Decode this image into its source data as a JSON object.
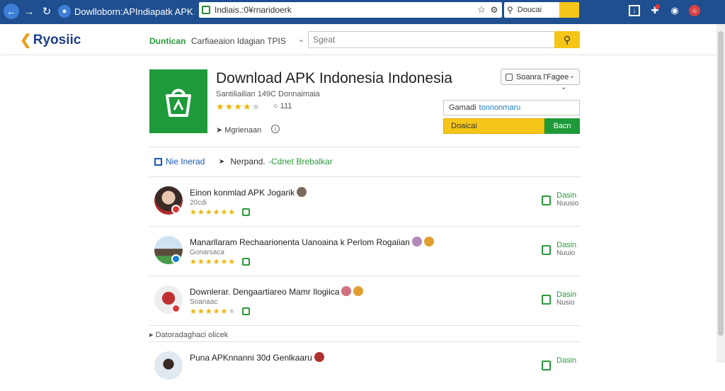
{
  "browser": {
    "tab_title": "Dowlloborn:APIndiapatk  APK",
    "url": "Indiais.:0¥rnaridoerk",
    "search_placeholder": "Doucai"
  },
  "site": {
    "logo": "Ryosiic",
    "nav_primary": "Duntican",
    "nav_secondary": "Carfiaeaion Idagian TPIS",
    "search_placeholder": "Sgeat"
  },
  "app": {
    "title": "Download APK Indonesia Indonesia",
    "subtitle": "Santiliailian 149C Donnaimaia",
    "rating_count": "111",
    "meta": "Mgrienaan",
    "dropdown_label": "Soanra l'Fagee",
    "field_label": "Gamadi",
    "field_value": "tonnonmaru",
    "download_label": "Doaicai",
    "secondary_label": "Bacn"
  },
  "tabs": [
    {
      "label": "Nie  Inerad"
    },
    {
      "label": "Nerpand."
    },
    {
      "label": "-Cdnet Brebalkar"
    }
  ],
  "items": [
    {
      "title": "Einon konmlad APK Jogarik",
      "sub": "20cdi",
      "action_top": "Dasin",
      "action_bottom": "Nuusio"
    },
    {
      "title": "Manarllaram Rechaarionenta Uanoaina k Perlom Rogaiian",
      "sub": "Gonarsaca",
      "action_top": "Dasin",
      "action_bottom": "Nuuio"
    },
    {
      "title": "Downlerar. Dengaartiareo Mamr Ilogiica",
      "sub": "Soanaac",
      "action_top": "Dasin",
      "action_bottom": "Nusio"
    },
    {
      "title": "Puna APKnnanni 30d Genlkaaru",
      "sub": "",
      "action_top": "Dasin",
      "action_bottom": ""
    }
  ],
  "section_label": "Datoradaghaci olicek",
  "colors": {
    "chrome": "#1f4f8f",
    "accent_yellow": "#f5c518",
    "accent_green": "#1e9a3a",
    "link_blue": "#1a5ab0"
  }
}
